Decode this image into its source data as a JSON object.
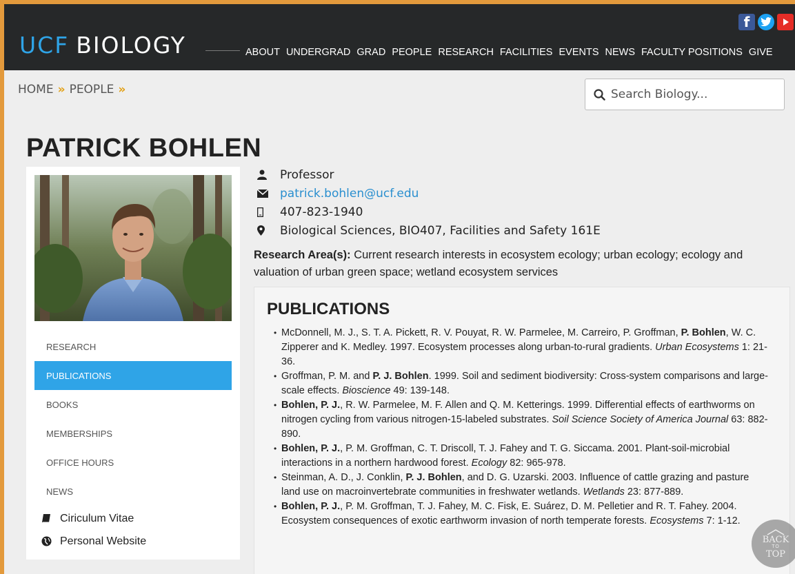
{
  "header": {
    "logo_ucf": "UCF",
    "logo_biology": "BIOLOGY",
    "nav": [
      "ABOUT",
      "UNDERGRAD",
      "GRAD",
      "PEOPLE",
      "RESEARCH",
      "FACILITIES",
      "EVENTS",
      "NEWS",
      "FACULTY POSITIONS",
      "GIVE"
    ],
    "social": [
      "facebook-icon",
      "twitter-icon",
      "youtube-icon"
    ]
  },
  "breadcrumb": {
    "home": "HOME",
    "people": "PEOPLE",
    "separator": "»"
  },
  "search": {
    "placeholder": "Search Biology..."
  },
  "profile": {
    "name": "PATRICK BOHLEN",
    "title": "Professor",
    "email": "patrick.bohlen@ucf.edu",
    "phone": "407-823-1940",
    "location": "Biological Sciences, BIO407, Facilities and Safety 161E",
    "research_label": "Research Area(s):",
    "research_text": " Current research interests in ecosystem ecology; urban ecology; ecology and valuation of urban green space; wetland ecosystem services"
  },
  "sidebar": {
    "items": [
      {
        "label": "RESEARCH",
        "active": false
      },
      {
        "label": "PUBLICATIONS",
        "active": true
      },
      {
        "label": "BOOKS",
        "active": false
      },
      {
        "label": "MEMBERSHIPS",
        "active": false
      },
      {
        "label": "OFFICE HOURS",
        "active": false
      },
      {
        "label": "NEWS",
        "active": false
      }
    ],
    "links": [
      {
        "label": "Ciriculum Vitae",
        "icon": "book-icon"
      },
      {
        "label": "Personal Website",
        "icon": "globe-icon"
      }
    ]
  },
  "publications": {
    "title": "PUBLICATIONS",
    "items": [
      {
        "parts": [
          [
            "",
            "McDonnell, M. J., S. T. A. Pickett, R. V. Pouyat, R. W. Parmelee, M. Carreiro, P. Groffman, "
          ],
          [
            "b",
            "P. Bohlen"
          ],
          [
            "",
            ", W. C. Zipperer and K. Medley.  1997.  Ecosystem processes along urban-to-rural gradients.  "
          ],
          [
            "i",
            "Urban Ecosystems"
          ],
          [
            "",
            " 1: 21-36."
          ]
        ]
      },
      {
        "parts": [
          [
            "",
            "Groffman, P. M. and "
          ],
          [
            "b",
            "P. J. Bohlen"
          ],
          [
            "",
            ".  1999.  Soil and sediment biodiversity: Cross-system comparisons and large-scale effects.  "
          ],
          [
            "i",
            "Bioscience"
          ],
          [
            "",
            " 49: 139-148."
          ]
        ]
      },
      {
        "parts": [
          [
            "b",
            "Bohlen, P. J."
          ],
          [
            "",
            ", R. W. Parmelee, M. F. Allen and Q. M. Ketterings.  1999.  Differential effects of earthworms on nitrogen cycling from various nitrogen-15-labeled substrates.  "
          ],
          [
            "i",
            "Soil Science Society of America Journal"
          ],
          [
            "",
            " 63: 882-890."
          ]
        ]
      },
      {
        "parts": [
          [
            "b",
            "Bohlen, P. J."
          ],
          [
            "",
            ", P. M. Groffman, C. T. Driscoll, T. J. Fahey and T. G. Siccama.  2001.  Plant-soil-microbial interactions in a northern hardwood forest.  "
          ],
          [
            "i",
            "Ecology"
          ],
          [
            "",
            " 82: 965-978."
          ]
        ]
      },
      {
        "parts": [
          [
            "",
            "Steinman, A. D., J. Conklin, "
          ],
          [
            "b",
            "P. J. Bohlen"
          ],
          [
            "",
            ", and D. G. Uzarski.  2003.  Influence of cattle grazing and pasture land use on macroinvertebrate communities in freshwater wetlands.  "
          ],
          [
            "i",
            "Wetlands"
          ],
          [
            "",
            " 23: 877-889."
          ]
        ]
      },
      {
        "parts": [
          [
            "b",
            "Bohlen, P. J."
          ],
          [
            "",
            ", P. M. Groffman, T. J. Fahey, M. C. Fisk, E. Suárez, D. M. Pelletier and R. T. Fahey.  2004.  Ecosystem consequences of exotic earthworm invasion of north temperate forests.  "
          ],
          [
            "i",
            "Ecosystems"
          ],
          [
            "",
            " 7: 1-12."
          ]
        ]
      }
    ]
  },
  "back_to_top": {
    "line1": "BACK",
    "line2": "TO",
    "line3": "TOP"
  },
  "colors": {
    "accent": "#2fa4e7",
    "header_bg": "#262829",
    "breadcrumb_sep": "#e3a21a",
    "frame": "#e39a3c"
  }
}
